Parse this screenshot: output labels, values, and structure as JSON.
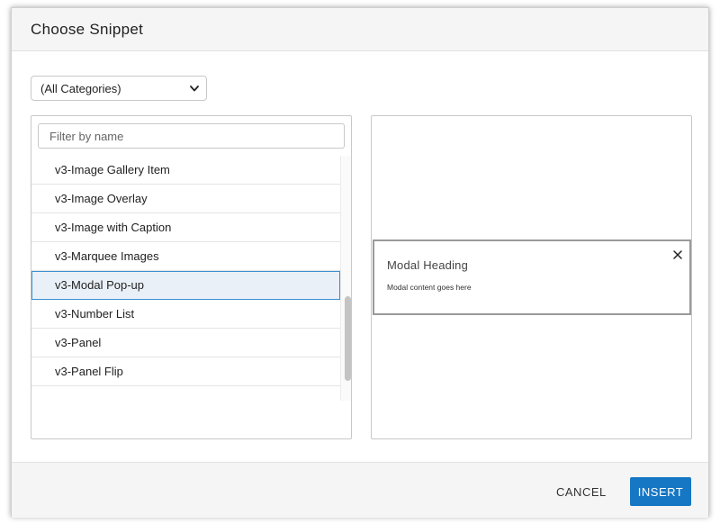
{
  "dialog": {
    "title": "Choose Snippet"
  },
  "category_select": {
    "value": "(All Categories)"
  },
  "filter": {
    "placeholder": "Filter by name",
    "value": ""
  },
  "snippets": {
    "items": [
      {
        "label": "v3-Image Gallery Item",
        "selected": false
      },
      {
        "label": "v3-Image Overlay",
        "selected": false
      },
      {
        "label": "v3-Image with Caption",
        "selected": false
      },
      {
        "label": "v3-Marquee Images",
        "selected": false
      },
      {
        "label": "v3-Modal Pop-up",
        "selected": true
      },
      {
        "label": "v3-Number List",
        "selected": false
      },
      {
        "label": "v3-Panel",
        "selected": false
      },
      {
        "label": "v3-Panel Flip",
        "selected": false
      }
    ]
  },
  "preview": {
    "modal_heading": "Modal Heading",
    "modal_content": "Modal content goes here",
    "close_icon": "close-icon"
  },
  "footer": {
    "cancel_label": "CANCEL",
    "insert_label": "INSERT"
  },
  "colors": {
    "accent": "#1677c4",
    "selected_row_bg": "#eaf0f8",
    "selected_row_border": "#3c8fd0"
  }
}
